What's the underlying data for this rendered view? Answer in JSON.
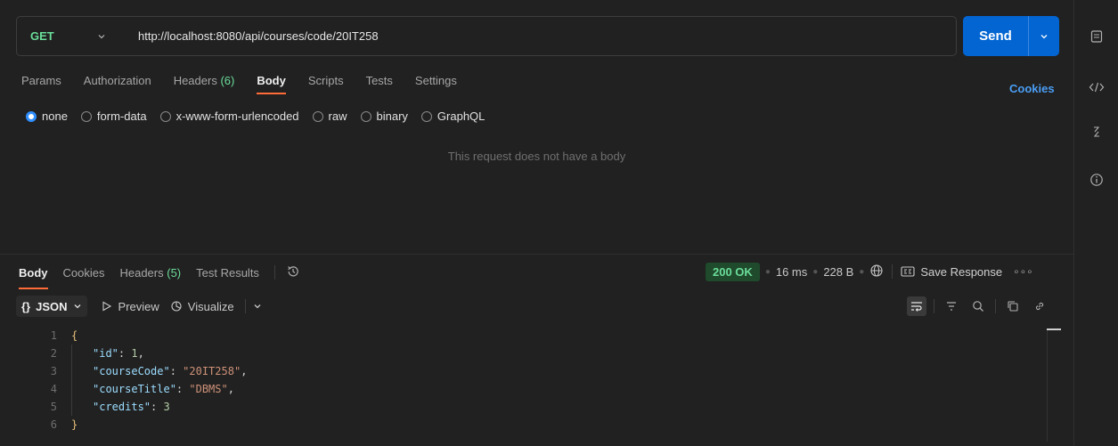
{
  "request": {
    "method": "GET",
    "url": "http://localhost:8080/api/courses/code/20IT258",
    "send_label": "Send"
  },
  "request_tabs": [
    {
      "label": "Params"
    },
    {
      "label": "Authorization"
    },
    {
      "label": "Headers",
      "count": "(6)"
    },
    {
      "label": "Body"
    },
    {
      "label": "Scripts"
    },
    {
      "label": "Tests"
    },
    {
      "label": "Settings"
    }
  ],
  "cookies_label": "Cookies",
  "body_types": [
    {
      "label": "none",
      "checked": true
    },
    {
      "label": "form-data"
    },
    {
      "label": "x-www-form-urlencoded"
    },
    {
      "label": "raw"
    },
    {
      "label": "binary"
    },
    {
      "label": "GraphQL"
    }
  ],
  "empty_body_message": "This request does not have a body",
  "response_tabs": [
    {
      "label": "Body"
    },
    {
      "label": "Cookies"
    },
    {
      "label": "Headers",
      "count": "(5)"
    },
    {
      "label": "Test Results"
    }
  ],
  "response_meta": {
    "status": "200 OK",
    "time": "16 ms",
    "size": "228 B",
    "save_label": "Save Response"
  },
  "response_toolbar": {
    "format": "JSON",
    "preview_label": "Preview",
    "visualize_label": "Visualize"
  },
  "code_lines": [
    {
      "n": "1",
      "text": "{"
    },
    {
      "n": "2",
      "key": "\"id\"",
      "value": "1",
      "type": "num",
      "comma": ","
    },
    {
      "n": "3",
      "key": "\"courseCode\"",
      "value": "\"20IT258\"",
      "type": "str",
      "comma": ","
    },
    {
      "n": "4",
      "key": "\"courseTitle\"",
      "value": "\"DBMS\"",
      "type": "str",
      "comma": ","
    },
    {
      "n": "5",
      "key": "\"credits\"",
      "value": "3",
      "type": "num",
      "comma": ""
    },
    {
      "n": "6",
      "text": "}"
    }
  ],
  "icons": [
    "documentation-icon",
    "code-icon",
    "related-icon",
    "info-icon"
  ],
  "colors": {
    "accent": "#ff6c37",
    "send": "#0265d2",
    "method": "#6bdd9a",
    "status": "#6bdd9a"
  }
}
